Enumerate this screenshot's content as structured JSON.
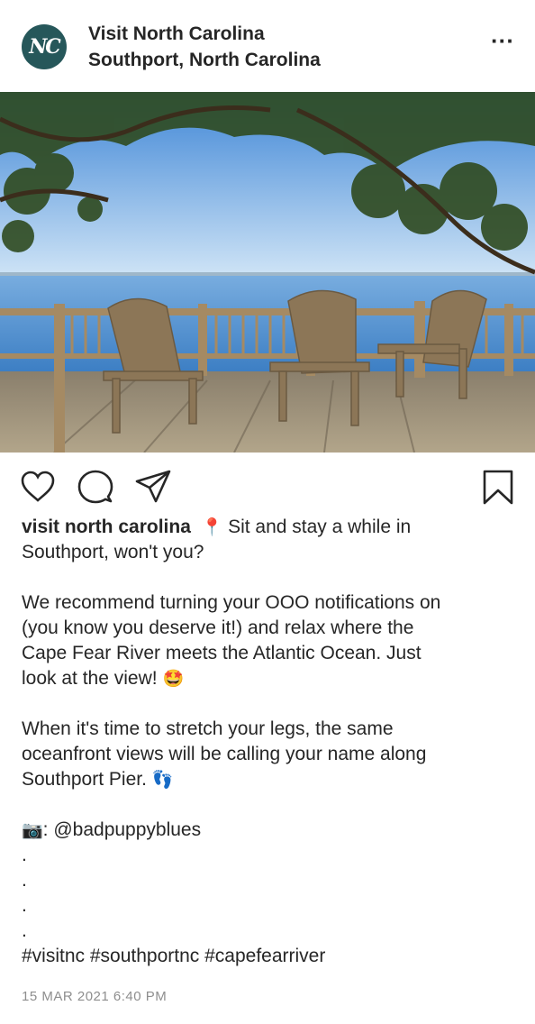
{
  "header": {
    "avatar_text": "NC",
    "account_name": "Visit North Carolina",
    "location": "Southport, North Carolina",
    "more_label": "···"
  },
  "photo": {
    "description_icon": "photo"
  },
  "actions": {
    "like_icon": "heart-icon",
    "comment_icon": "comment-icon",
    "share_icon": "share-icon",
    "save_icon": "bookmark-icon"
  },
  "caption": {
    "username": "visit north carolina",
    "pin": "📍",
    "line1": "Sit and stay a while in",
    "line2": "Southport, won't you?",
    "para2_l1": "We recommend turning your OOO notifications on",
    "para2_l2": "(you know you deserve it!) and relax where the",
    "para2_l3": "Cape Fear River meets the Atlantic Ocean. Just",
    "para2_l4": "look at the view!",
    "star_emoji": "🤩",
    "para3_l1": "When it's time to stretch your legs, the same",
    "para3_l2": "oceanfront views will be calling your name along",
    "para3_l3": "Southport Pier.",
    "feet_emoji": "👣",
    "camera_emoji": "📷",
    "credit": ": @badpuppyblues",
    "dot": ".",
    "hashtags": "#visitnc #southportnc #capefearriver"
  },
  "timestamp": "15 MAR 2021 6:40 PM",
  "colors": {
    "avatar_bg": "#26575a",
    "text": "#262626",
    "muted": "#8e8e8e"
  }
}
